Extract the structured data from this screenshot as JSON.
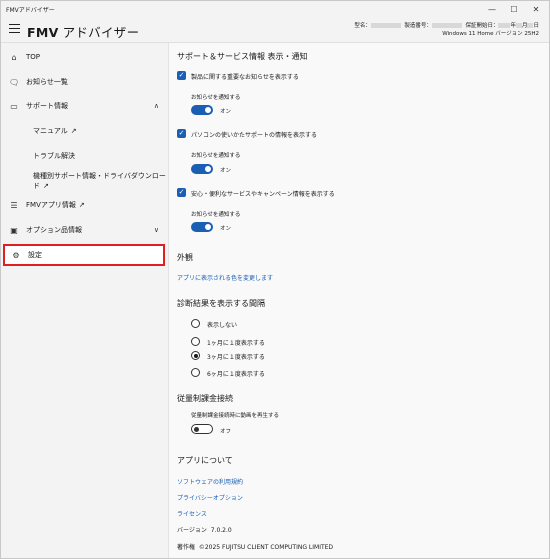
{
  "window": {
    "title": "FMVアドバイザー",
    "minimize": "—",
    "maximize": "☐",
    "close": "✕"
  },
  "header": {
    "brand": "FMV",
    "brand_sub": "アドバイザー",
    "model_label": "型名：",
    "serial_label": "製造番号：",
    "warranty_label": "保証開始日：",
    "warranty_year": "年",
    "warranty_month": "月",
    "warranty_day": "日",
    "os": "Windows 11 Home バージョン 25H2"
  },
  "sidebar": {
    "items": [
      {
        "label": "TOP",
        "icon": "home-icon"
      },
      {
        "label": "お知らせ一覧",
        "icon": "chat-icon"
      },
      {
        "label": "サポート情報",
        "icon": "monitor-icon",
        "chevron": "∧"
      },
      {
        "label": "マニュアル",
        "external": "↗"
      },
      {
        "label": "トラブル解決"
      },
      {
        "label": "機種別サポート情報・ドライバダウンロード",
        "external": "↗"
      },
      {
        "label": "FMVアプリ情報",
        "icon": "list-icon",
        "external": "↗"
      },
      {
        "label": "オプション品情報",
        "icon": "box-icon",
        "chevron": "∨"
      },
      {
        "label": "設定",
        "icon": "gear-icon"
      }
    ]
  },
  "settings": {
    "notify_title": "サポート＆サービス情報 表示・通知",
    "notify_label": "お知らせを通知する",
    "on_label": "オン",
    "off_label": "オフ",
    "items": [
      {
        "label": "製品に関する重要なお知らせを表示する",
        "checked": true,
        "notify": true
      },
      {
        "label": "パソコンの使いかたサポートの情報を表示する",
        "checked": true,
        "notify": true
      },
      {
        "label": "安心・便利なサービスやキャンペーン情報を表示する",
        "checked": true,
        "notify": true
      }
    ],
    "appearance_title": "外観",
    "appearance_link": "アプリに表示される色を変更します",
    "interval_title": "診断結果を表示する間隔",
    "interval_options": [
      "表示しない",
      "1ヶ月に１度表示する",
      "3ヶ月に１度表示する",
      "6ヶ月に１度表示する"
    ],
    "interval_selected": 2,
    "metered_title": "従量制課金接続",
    "metered_label": "従量制課金接続時に動画を再生する",
    "metered_on": false,
    "about_title": "アプリについて",
    "about_links": [
      "ソフトウェアの利用規約",
      "プライバシーオプション",
      "ライセンス"
    ],
    "version_label": "バージョン",
    "version": "7.0.2.0",
    "copyright_label": "著作権",
    "copyright": "©2025 FUJITSU CLIENT COMPUTING LIMITED"
  }
}
